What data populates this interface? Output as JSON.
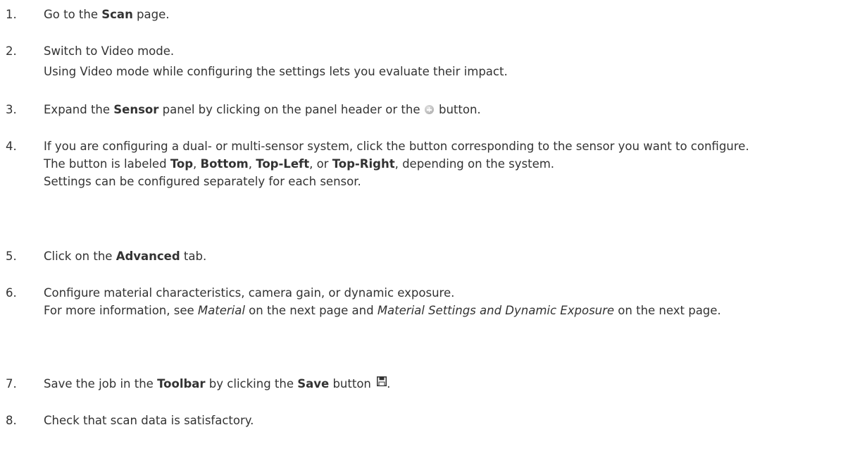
{
  "steps": [
    {
      "num": "1.",
      "parts": {
        "a": "Go to the ",
        "b": "Scan",
        "c": " page."
      }
    },
    {
      "num": "2.",
      "line1": "Switch to Video mode.",
      "line2": "Using Video mode while configuring the settings lets you evaluate their impact."
    },
    {
      "num": "3.",
      "parts": {
        "a": "Expand the ",
        "b": "Sensor",
        "c": " panel by clicking on the panel header or the ",
        "d": " button."
      },
      "icon": "plus-circle-icon"
    },
    {
      "num": "4.",
      "line1": "If you are configuring a dual- or multi-sensor system, click the button corresponding to the sensor you want to configure.",
      "line2": {
        "a": "The button is labeled ",
        "b": "Top",
        "c": ", ",
        "d": "Bottom",
        "e": ", ",
        "f": "Top-Left",
        "g": ", or ",
        "h": "Top-Right",
        "i": ", depending on the system."
      },
      "line3": "Settings can be configured separately for each sensor."
    },
    {
      "num": "5.",
      "parts": {
        "a": "Click on the ",
        "b": "Advanced",
        "c": " tab."
      }
    },
    {
      "num": "6.",
      "line1": "Configure material characteristics, camera gain, or dynamic exposure.",
      "line2": {
        "a": "For more information, see ",
        "b": "Material",
        "c": " on the next page and ",
        "d": "Material Settings and Dynamic Exposure",
        "e": " on the next page."
      }
    },
    {
      "num": "7.",
      "parts": {
        "a": "Save the job in the ",
        "b": "Toolbar",
        "c": " by clicking the ",
        "d": "Save",
        "e": " button ",
        "f": "."
      },
      "icon": "save-disk-icon"
    },
    {
      "num": "8.",
      "line1": "Check that scan data is satisfactory."
    }
  ],
  "colors": {
    "text": "#333333",
    "icon_gray": "#a8a8a8"
  }
}
